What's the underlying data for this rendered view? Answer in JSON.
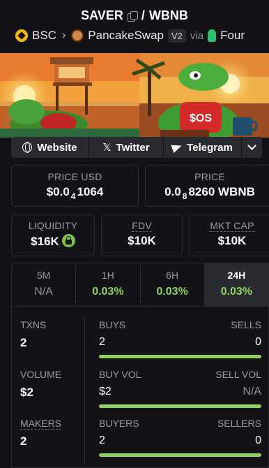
{
  "header": {
    "token": "SAVER",
    "separator": "/",
    "quote": "WBNB",
    "chain": "BSC",
    "dex": "PancakeSwap",
    "version": "V2",
    "via_label": "via",
    "via_source": "Four"
  },
  "links": {
    "website": "Website",
    "twitter": "Twitter",
    "telegram": "Telegram"
  },
  "price_usd": {
    "label": "PRICE USD",
    "prefix": "$0.0",
    "zeros": "4",
    "digits": "1064"
  },
  "price_native": {
    "label": "PRICE",
    "prefix": "0.0",
    "zeros": "8",
    "digits": "8260 WBNB"
  },
  "liquidity": {
    "label": "LIQUIDITY",
    "value": "$16K"
  },
  "fdv": {
    "label": "FDV",
    "value": "$10K"
  },
  "mktcap": {
    "label": "MKT CAP",
    "value": "$10K"
  },
  "tabs": [
    {
      "label": "5M",
      "value": "N/A"
    },
    {
      "label": "1H",
      "value": "0.03%"
    },
    {
      "label": "6H",
      "value": "0.03%"
    },
    {
      "label": "24H",
      "value": "0.03%"
    }
  ],
  "stats": {
    "txns": {
      "label": "TXNS",
      "value": "2"
    },
    "volume": {
      "label": "VOLUME",
      "value": "$2"
    },
    "makers": {
      "label": "MAKERS",
      "value": "2"
    },
    "buys": {
      "label": "BUYS",
      "value": "2"
    },
    "sells": {
      "label": "SELLS",
      "value": "0"
    },
    "buy_vol": {
      "label": "BUY VOL",
      "value": "$2"
    },
    "sell_vol": {
      "label": "SELL VOL",
      "value": "N/A"
    },
    "buyers": {
      "label": "BUYERS",
      "value": "2"
    },
    "sellers": {
      "label": "SELLERS",
      "value": "0"
    }
  },
  "banner_text": "$OS",
  "colors": {
    "positive": "#8fd160",
    "card_bg": "#2a2a31",
    "page_bg": "#131317"
  }
}
